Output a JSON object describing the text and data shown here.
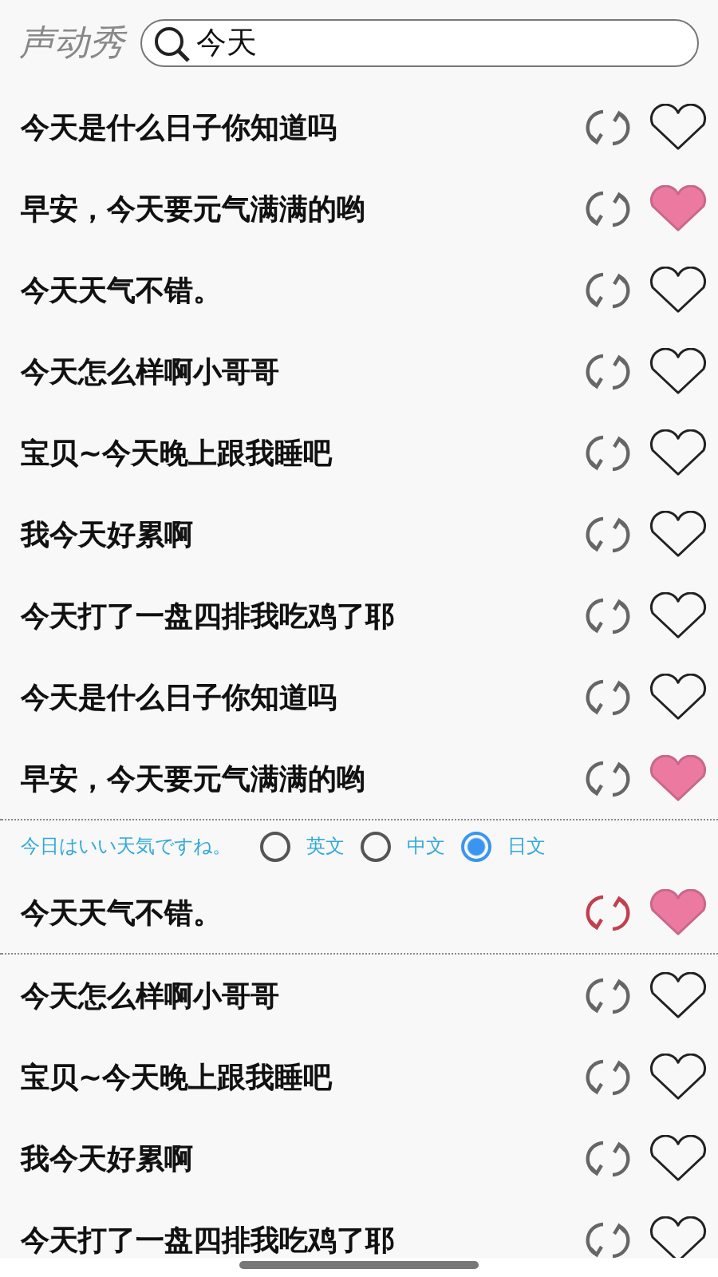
{
  "app_title": "声动秀",
  "search": {
    "value": "今天"
  },
  "phrases": [
    {
      "text": "今天是什么日子你知道吗",
      "liked": false,
      "active": false
    },
    {
      "text": "早安，今天要元气满满的哟",
      "liked": true,
      "active": false
    },
    {
      "text": "今天天气不错。",
      "liked": false,
      "active": false
    },
    {
      "text": "今天怎么样啊小哥哥",
      "liked": false,
      "active": false
    },
    {
      "text": "宝贝~今天晚上跟我睡吧",
      "liked": false,
      "active": false
    },
    {
      "text": "我今天好累啊",
      "liked": false,
      "active": false
    },
    {
      "text": "今天打了一盘四排我吃鸡了耶",
      "liked": false,
      "active": false
    },
    {
      "text": "今天是什么日子你知道吗",
      "liked": false,
      "active": false
    },
    {
      "text": "早安，今天要元气满满的哟",
      "liked": true,
      "active": false
    },
    {
      "text": "今天天气不错。",
      "liked": true,
      "active": true,
      "translation": "今日はいい天気ですね。",
      "languages": [
        {
          "label": "英文",
          "selected": false
        },
        {
          "label": "中文",
          "selected": false
        },
        {
          "label": "日文",
          "selected": true
        }
      ]
    },
    {
      "text": "今天怎么样啊小哥哥",
      "liked": false,
      "active": false
    },
    {
      "text": "宝贝~今天晚上跟我睡吧",
      "liked": false,
      "active": false
    },
    {
      "text": "我今天好累啊",
      "liked": false,
      "active": false
    },
    {
      "text": "今天打了一盘四排我吃鸡了耶",
      "liked": false,
      "active": false
    }
  ]
}
